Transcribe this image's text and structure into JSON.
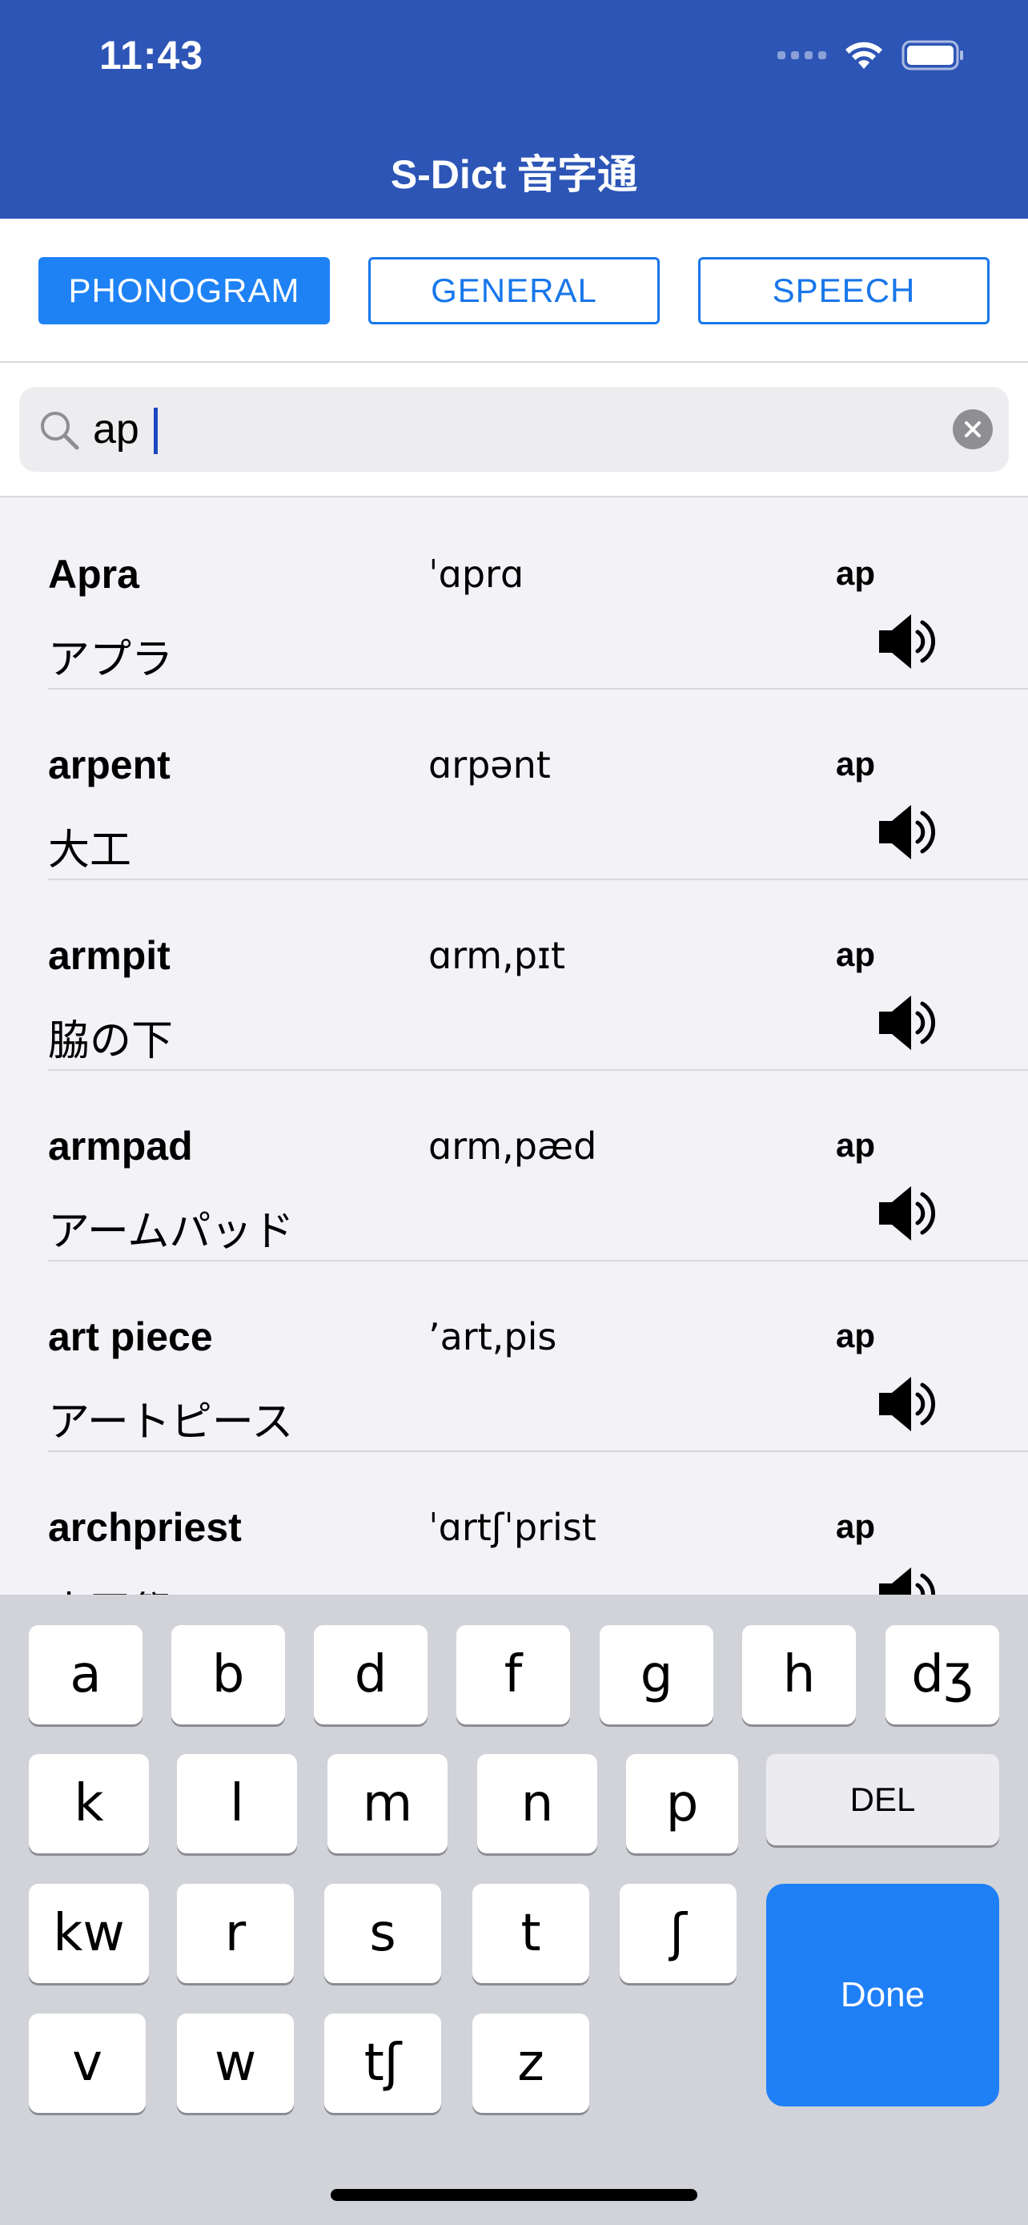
{
  "status": {
    "time": "11:43"
  },
  "header": {
    "title": "S-Dict 音字通"
  },
  "modes": [
    {
      "label": "PHONOGRAM",
      "active": true
    },
    {
      "label": "GENERAL",
      "active": false
    },
    {
      "label": "SPEECH",
      "active": false
    }
  ],
  "search": {
    "value": "ap",
    "placeholder": ""
  },
  "results": [
    {
      "word": "Apra",
      "phonetic": "ˈɑprɑ",
      "tag": "ap",
      "meaning": "アプラ"
    },
    {
      "word": "arpent",
      "phonetic": "ɑrpənt",
      "tag": "ap",
      "meaning": "大工"
    },
    {
      "word": "armpit",
      "phonetic": "ɑrm,pɪt",
      "tag": "ap",
      "meaning": "脇の下"
    },
    {
      "word": "armpad",
      "phonetic": "ɑrm,pæd",
      "tag": "ap",
      "meaning": "アームパッド"
    },
    {
      "word": "art piece",
      "phonetic": "ʼart,pis",
      "tag": "ap",
      "meaning": "アートピース"
    },
    {
      "word": "archpriest",
      "phonetic": "ˈɑrtʃˈprist",
      "tag": "ap",
      "meaning": "大司祭"
    }
  ],
  "keyboard": {
    "row1": [
      "a",
      "b",
      "d",
      "f",
      "g",
      "h",
      "dʒ"
    ],
    "row2": [
      "k",
      "l",
      "m",
      "n",
      "p"
    ],
    "row3": [
      "kw",
      "r",
      "s",
      "t",
      "ʃ"
    ],
    "row4": [
      "v",
      "w",
      "tʃ",
      "z"
    ],
    "del_label": "DEL",
    "done_label": "Done"
  },
  "colors": {
    "header": "#2d55b6",
    "accent": "#1e82f5",
    "done": "#1f7ff6"
  }
}
